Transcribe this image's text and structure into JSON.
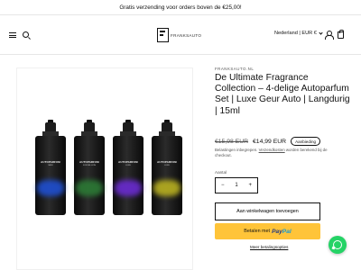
{
  "announcement": "Gratis verzending voor orders boven de €25,00!",
  "header": {
    "logo_text": "FRANKSAUTO",
    "locale": "Nederland | EUR €"
  },
  "gallery": {
    "bottles": [
      {
        "label": "AUTOPARFUM",
        "sub": "NEW",
        "glow": "#1f4fd1"
      },
      {
        "label": "AUTOPARFUM",
        "sub": "FOR MILLION",
        "glow": "#2c7a35"
      },
      {
        "label": "AUTOPARFUM",
        "sub": "LUXE",
        "glow": "#6a2bd1"
      },
      {
        "label": "AUTOPARFUM",
        "sub": "LUXE",
        "glow": "#b8b020"
      }
    ]
  },
  "product": {
    "vendor": "FRANKSAUTO.NL",
    "title": "De Ultimate Fragrance Collection – 4-delige Autoparfum Set | Luxe Geur Auto | Langdurig | 15ml",
    "price_old": "€15,98 EUR",
    "price_new": "€14,99 EUR",
    "badge": "Aanbieding",
    "tax_text": "Belastingen inbegrepen.",
    "shipping_link": "Verzendkosten",
    "tax_text_after": "worden berekend bij de checkout.",
    "quantity_label": "Aantal",
    "quantity": "1",
    "minus": "−",
    "plus": "+",
    "add_to_cart": "Aan winkelwagen toevoegen",
    "paypal_prefix": "Betalen met",
    "paypal_pay": "Pay",
    "paypal_pal": "Pal",
    "more_payment": "Meer betalingsopties"
  },
  "colors": {
    "accent": "#121212",
    "paypal": "#ffc439",
    "whatsapp": "#25d366"
  },
  "icons": [
    "hamburger-icon",
    "search-icon",
    "user-icon",
    "cart-icon",
    "whatsapp-icon"
  ]
}
